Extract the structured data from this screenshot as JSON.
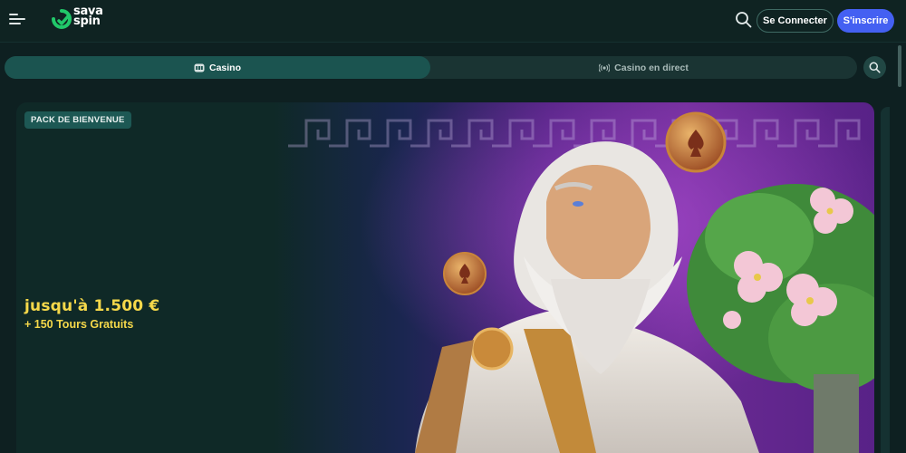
{
  "header": {
    "logo_line1": "sava",
    "logo_line2": "spin",
    "login_label": "Se Connecter",
    "register_label": "S'inscrire"
  },
  "tabs": [
    {
      "label": "Casino",
      "active": true
    },
    {
      "label": "Casino en direct",
      "active": false
    }
  ],
  "banner": {
    "badge": "PACK DE BIENVENUE",
    "amount": "jusqu'à 1.500 €",
    "spins": "+ 150 Tours Gratuits"
  },
  "colors": {
    "brand_green": "#21c86a",
    "register_blue": "#4460f2",
    "promo_yellow": "#f5d84a",
    "active_tab": "#1b5450"
  }
}
